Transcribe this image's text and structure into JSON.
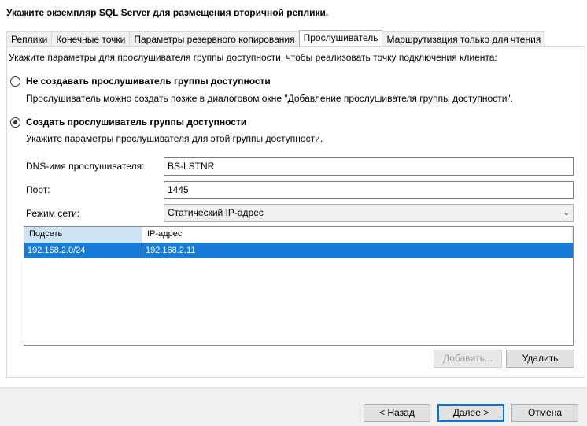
{
  "page_title": "Укажите экземпляр SQL Server для размещения вторичной реплики.",
  "tabs": [
    {
      "label": "Реплики"
    },
    {
      "label": "Конечные точки"
    },
    {
      "label": "Параметры резервного копирования"
    },
    {
      "label": "Прослушиватель",
      "active": true
    },
    {
      "label": "Маршрутизация только для чтения"
    }
  ],
  "intro_text": "Укажите параметры для прослушивателя группы доступности, чтобы реализовать точку подключения клиента:",
  "option_none": {
    "label": "Не создавать прослушиватель группы доступности",
    "description": "Прослушиватель можно создать позже в диалоговом окне \"Добавление прослушивателя группы доступности\".",
    "selected": false
  },
  "option_create": {
    "label": "Создать прослушиватель группы доступности",
    "description": "Укажите параметры прослушивателя для этой группы доступности.",
    "selected": true
  },
  "fields": {
    "dns_label": "DNS-имя прослушивателя:",
    "dns_value": "BS-LSTNR",
    "port_label": "Порт:",
    "port_value": "1445",
    "mode_label": "Режим сети:",
    "mode_value": "Статический IP-адрес"
  },
  "grid": {
    "columns": [
      "Подсеть",
      "IP-адрес"
    ],
    "rows": [
      {
        "subnet": "192.168.2.0/24",
        "ip": "192.168.2.11"
      }
    ]
  },
  "grid_buttons": {
    "add": "Добавить...",
    "remove": "Удалить"
  },
  "footer": {
    "back": "< Назад",
    "next": "Далее >",
    "cancel": "Отмена"
  },
  "colors": {
    "selection": "#1879d7",
    "header_highlight": "#cde4f7",
    "primary_border": "#0078d7"
  }
}
